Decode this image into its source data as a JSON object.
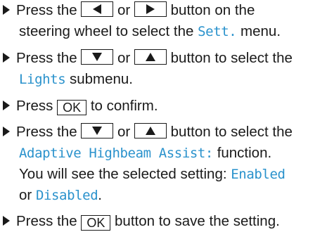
{
  "colors": {
    "display_text": "#2a92cc",
    "body_text": "#1a1a1a"
  },
  "icons": {
    "bullet": "triangle-right-bullet",
    "left": "left-arrow",
    "right": "right-arrow",
    "down": "down-arrow",
    "up": "up-arrow"
  },
  "steps": [
    {
      "a1": "Press the",
      "a2": "or",
      "a3": "button on the",
      "b1": "steering wheel to select the",
      "b2": "Sett.",
      "b3": "menu."
    },
    {
      "a1": "Press the",
      "a2": "or",
      "a3": "button to select the",
      "b1": "Lights",
      "b2": "submenu."
    },
    {
      "a1": "Press",
      "key": "OK",
      "a2": "to confirm."
    },
    {
      "a1": "Press the",
      "a2": "or",
      "a3": "button to select the",
      "b1": "Adaptive Highbeam Assist:",
      "b2": "function.",
      "c1": "You will see the selected setting:",
      "c2": "Enabled",
      "d1": "or",
      "d2": "Disabled",
      "d3": "."
    },
    {
      "a1": "Press the",
      "key": "OK",
      "a2": "button to save the setting."
    }
  ]
}
